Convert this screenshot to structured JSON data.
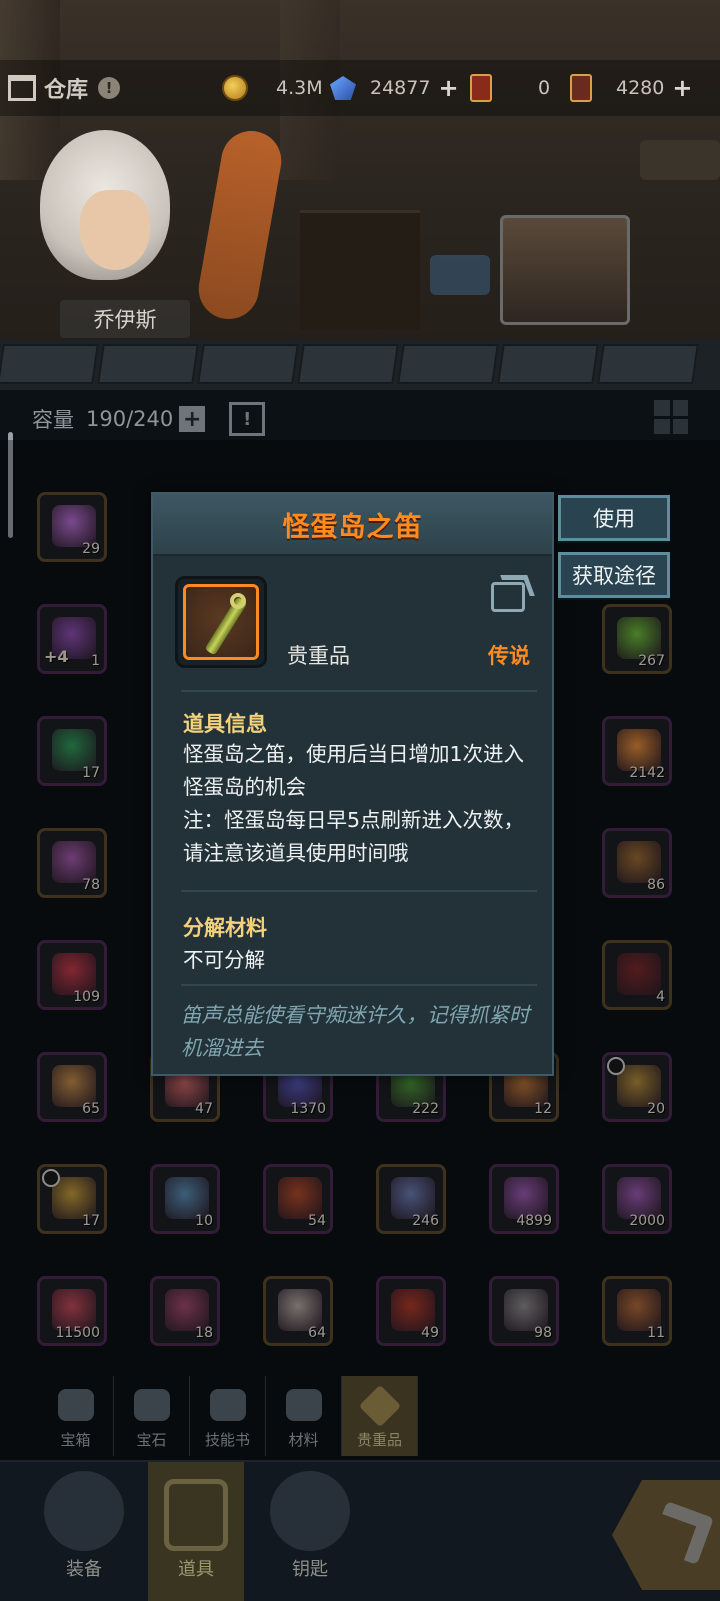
{
  "header": {
    "title": "仓库",
    "info_icon": "!",
    "currencies": [
      {
        "icon": "coin-icon",
        "value": "4.3M"
      },
      {
        "icon": "crystal-icon",
        "value": "24877"
      },
      {
        "icon": "red-card-icon",
        "value": "0"
      },
      {
        "icon": "ticket-icon",
        "value": "4280"
      }
    ],
    "hero_name": "乔伊斯"
  },
  "capacity": {
    "label": "容量",
    "value": "190/240",
    "calendar_mark": "!"
  },
  "inventory": {
    "rows": [
      [
        {
          "count": "29",
          "color": "#b46dd0"
        },
        {
          "count": "",
          "color": ""
        },
        {
          "count": "",
          "color": ""
        },
        {
          "count": "",
          "color": ""
        },
        {
          "count": "",
          "color": ""
        },
        {
          "count": "",
          "color": ""
        }
      ],
      [
        {
          "count": "1",
          "badge": "+4",
          "color": "#8a4fb0"
        },
        {
          "count": "",
          "color": ""
        },
        {
          "count": "",
          "color": ""
        },
        {
          "count": "",
          "color": ""
        },
        {
          "count": "",
          "color": ""
        },
        {
          "count": "267",
          "color": "#6cba3a"
        }
      ],
      [
        {
          "count": "17",
          "color": "#2f9a5a"
        },
        {
          "count": "",
          "color": ""
        },
        {
          "count": "",
          "color": ""
        },
        {
          "count": "",
          "color": ""
        },
        {
          "count": "",
          "color": ""
        },
        {
          "count": "2142",
          "color": "#e08a3a"
        }
      ],
      [
        {
          "count": "78",
          "color": "#a05aa8"
        },
        {
          "count": "",
          "color": ""
        },
        {
          "count": "",
          "color": ""
        },
        {
          "count": "",
          "color": ""
        },
        {
          "count": "",
          "color": ""
        },
        {
          "count": "86",
          "color": "#9a6a34"
        }
      ],
      [
        {
          "count": "109",
          "color": "#c03a4a"
        },
        {
          "count": "",
          "color": ""
        },
        {
          "count": "",
          "color": ""
        },
        {
          "count": "",
          "color": ""
        },
        {
          "count": "",
          "color": ""
        },
        {
          "count": "4",
          "color": "#7a2a2a"
        }
      ],
      [
        {
          "count": "65",
          "color": "#c08a4a"
        },
        {
          "count": "47",
          "color": "#d06a6a"
        },
        {
          "count": "1370",
          "color": "#5a5ac0"
        },
        {
          "count": "222",
          "color": "#4a9a3a"
        },
        {
          "count": "12",
          "color": "#c07a3a"
        },
        {
          "count": "20",
          "color": "#b08a3a",
          "clock": true
        }
      ],
      [
        {
          "count": "17",
          "color": "#c09a3a",
          "clock": true
        },
        {
          "count": "10",
          "color": "#5a8ab0"
        },
        {
          "count": "54",
          "color": "#b04a2a"
        },
        {
          "count": "246",
          "color": "#6a7ab0"
        },
        {
          "count": "4899",
          "color": "#9a5ab0"
        },
        {
          "count": "2000",
          "color": "#9a5ab0"
        }
      ],
      [
        {
          "count": "11500",
          "color": "#c04a5a"
        },
        {
          "count": "18",
          "color": "#a04a6a"
        },
        {
          "count": "64",
          "color": "#b0a6a0"
        },
        {
          "count": "49",
          "color": "#b03a2a"
        },
        {
          "count": "98",
          "color": "#8a8a8a"
        },
        {
          "count": "11",
          "color": "#b06a3a"
        }
      ]
    ]
  },
  "categories": [
    {
      "label": "宝箱",
      "icon": "chest-icon"
    },
    {
      "label": "宝石",
      "icon": "gem-icon"
    },
    {
      "label": "技能书",
      "icon": "book-icon"
    },
    {
      "label": "材料",
      "icon": "material-icon"
    },
    {
      "label": "贵重品",
      "icon": "valuable-icon",
      "active": true
    }
  ],
  "bottom_nav": [
    {
      "label": "装备",
      "icon": "equipment-icon"
    },
    {
      "label": "道具",
      "icon": "item-bag-icon",
      "active": true
    },
    {
      "label": "钥匙",
      "icon": "key-icon"
    }
  ],
  "popup": {
    "title": "怪蛋岛之笛",
    "class_label": "贵重品",
    "rarity": "传说",
    "info_title": "道具信息",
    "info_text": "怪蛋岛之笛，使用后当日增加1次进入怪蛋岛的机会",
    "note_text": "注：怪蛋岛每日早5点刷新进入次数，请注意该道具使用时间哦",
    "decompose_title": "分解材料",
    "decompose_text": "不可分解",
    "flavor_text": "笛声总能使看守痴迷许久，记得抓紧时机溜进去"
  },
  "actions": {
    "use": "使用",
    "obtain": "获取途径"
  }
}
